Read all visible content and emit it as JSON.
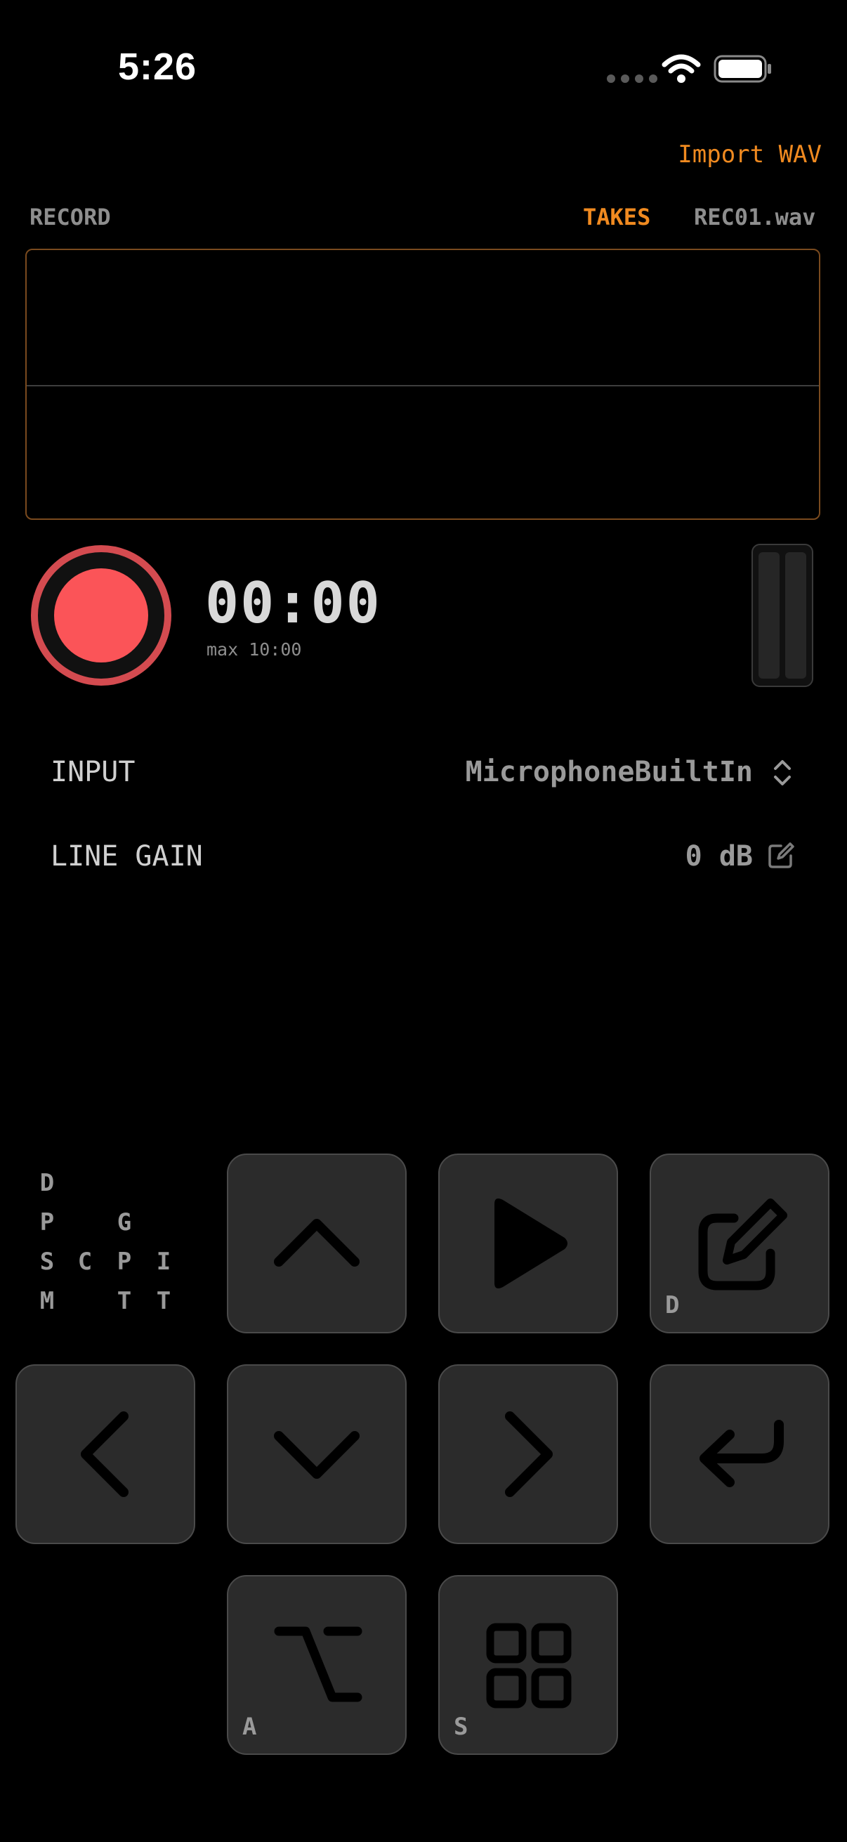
{
  "status_bar": {
    "time": "5:26"
  },
  "header": {
    "import_label": "Import WAV"
  },
  "tabs": {
    "record": "RECORD",
    "takes": "TAKES",
    "file": "REC01.wav"
  },
  "recorder": {
    "timer": "00:00",
    "max_label": "max 10:00"
  },
  "settings": {
    "input_label": "INPUT",
    "input_value": "MicrophoneBuiltIn",
    "gain_label": "LINE GAIN",
    "gain_value": "0 dB"
  },
  "letter_grid": {
    "col1": [
      "D",
      "P",
      "S",
      "M"
    ],
    "col2": [
      "C"
    ],
    "col3": [
      "G",
      "P",
      "T"
    ],
    "col4": [
      "I",
      "T"
    ]
  },
  "keypad": {
    "edit_key_label": "D",
    "option_key_label": "A",
    "grid_key_label": "S"
  },
  "colors": {
    "accent": "#f08a20",
    "record": "#fb5458",
    "record_ring": "#d44b50",
    "key_bg": "#2b2b2b"
  }
}
